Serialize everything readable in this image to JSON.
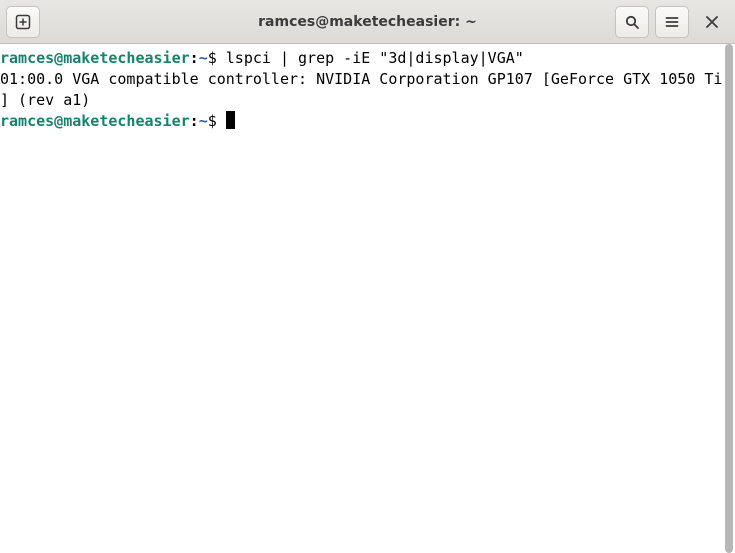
{
  "window": {
    "title": "ramces@maketecheasier: ~"
  },
  "prompt": {
    "userhost": "ramces@maketecheasier",
    "sep": ":",
    "path": "~",
    "sigil": "$"
  },
  "lines": {
    "cmd1": "lspci | grep -iE \"3d|display|VGA\"",
    "out1a": "01:00.0 VGA compatible controller: NVIDIA Corporation GP107 [GeForce GTX 1050 Ti",
    "out1b": "] (rev a1)"
  },
  "icons": {
    "new_tab": "new-tab-icon",
    "search": "search-icon",
    "menu": "hamburger-icon",
    "close": "close-icon"
  }
}
